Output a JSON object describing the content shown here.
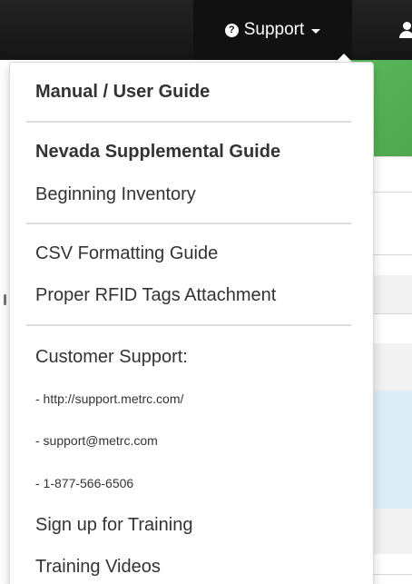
{
  "navbar": {
    "support_label": "Support",
    "help_icon": "question-circle-icon",
    "caret_icon": "caret-down-icon",
    "user_icon": "user-icon"
  },
  "support_menu": {
    "manual": "Manual / User Guide",
    "supplemental": "Nevada Supplemental Guide",
    "beginning_inventory": "Beginning Inventory",
    "csv_guide": "CSV Formatting Guide",
    "rfid_guide": "Proper RFID Tags Attachment",
    "customer_support": "Customer Support:",
    "support_url": "- http://support.metrc.com/",
    "support_email": "- support@metrc.com",
    "support_phone": "- 1-877-566-6506",
    "sign_up_training": "Sign up for Training",
    "training_videos": "Training Videos"
  },
  "colors": {
    "navbar": "#151515",
    "accent_green": "#5cb85c",
    "menu_text": "#333333",
    "row_highlight": "#dcedf7"
  }
}
